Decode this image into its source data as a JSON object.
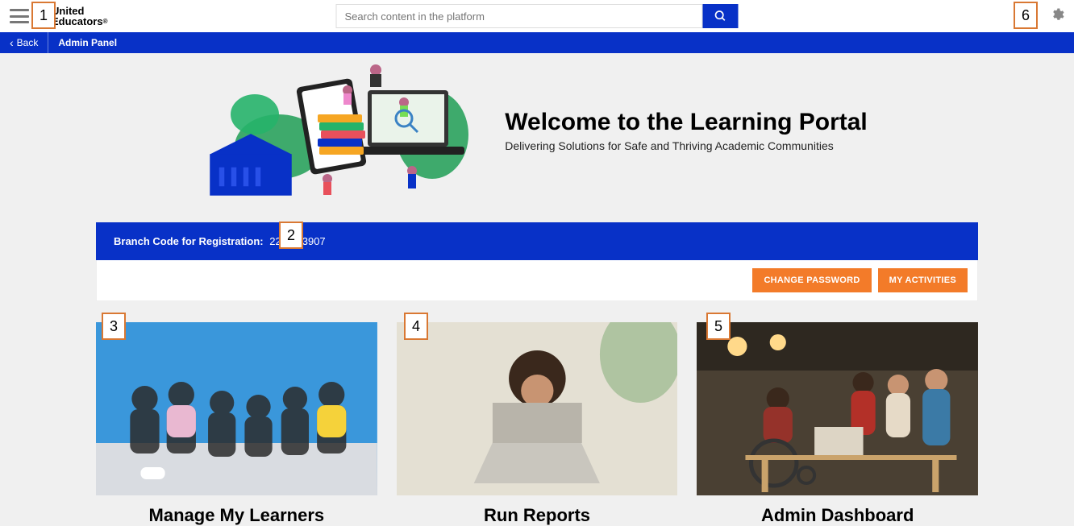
{
  "header": {
    "logo_line1": "United",
    "logo_line2": "Educators",
    "search_placeholder": "Search content in the platform"
  },
  "bluebar": {
    "back": "Back",
    "admin_panel": "Admin Panel"
  },
  "hero": {
    "title": "Welcome to the Learning Portal",
    "subtitle": "Delivering Solutions for Safe and Thriving Academic Communities"
  },
  "branch": {
    "label": "Branch Code for Registration:",
    "code": "2278-93907"
  },
  "actions": {
    "change_password": "CHANGE PASSWORD",
    "my_activities": "MY ACTIVITIES"
  },
  "cards": [
    {
      "title": "Manage My Learners"
    },
    {
      "title": "Run Reports"
    },
    {
      "title": "Admin Dashboard"
    }
  ],
  "annotations": {
    "a1": "1",
    "a2": "2",
    "a3": "3",
    "a4": "4",
    "a5": "5",
    "a6": "6"
  }
}
